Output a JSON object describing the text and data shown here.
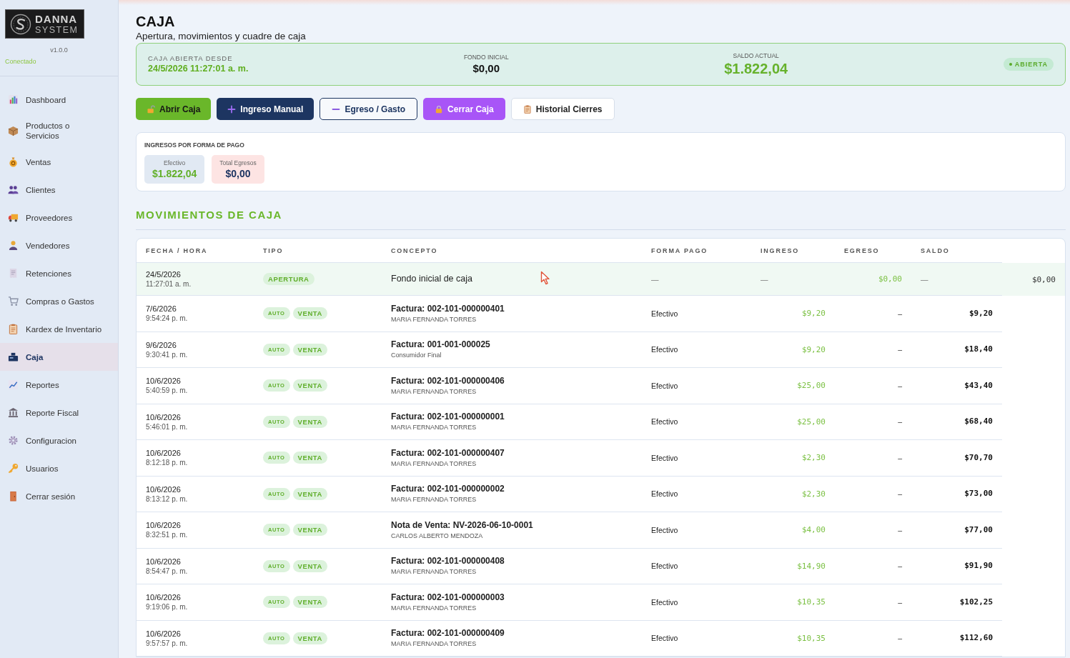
{
  "sidebar": {
    "logo": {
      "name": "DANNA",
      "subtitle": "SYSTEM"
    },
    "version": "v1.0.0",
    "connection": "Conectado",
    "items": [
      {
        "label": "Dashboard",
        "selected": false
      },
      {
        "label": "Productos o Servicios",
        "selected": false
      },
      {
        "label": "Ventas",
        "selected": false
      },
      {
        "label": "Clientes",
        "selected": false
      },
      {
        "label": "Proveedores",
        "selected": false
      },
      {
        "label": "Vendedores",
        "selected": false
      },
      {
        "label": "Retenciones",
        "selected": false
      },
      {
        "label": "Compras o Gastos",
        "selected": false
      },
      {
        "label": "Kardex de Inventario",
        "selected": false
      },
      {
        "label": "Caja",
        "selected": true
      },
      {
        "label": "Reportes",
        "selected": false
      },
      {
        "label": "Reporte Fiscal",
        "selected": false
      },
      {
        "label": "Configuracion",
        "selected": false
      },
      {
        "label": "Usuarios",
        "selected": false
      },
      {
        "label": "Cerrar sesión",
        "selected": false
      }
    ]
  },
  "header": {
    "title": "CAJA",
    "subtitle": "Apertura, movimientos y cuadre de caja"
  },
  "status_card": {
    "since_label": "CAJA ABIERTA DESDE",
    "since": "24/5/2026 11:27:01 a. m.",
    "fund_label": "FONDO INICIAL",
    "fund": "$0,00",
    "balance_label": "SALDO ACTUAL",
    "balance": "$1.822,04",
    "badge": "ABIERTA"
  },
  "actions": [
    {
      "label": "Abrir Caja",
      "kind": "success"
    },
    {
      "label": "Ingreso Manual",
      "kind": "primary"
    },
    {
      "label": "Egreso / Gasto",
      "kind": "outline"
    },
    {
      "label": "Cerrar Caja",
      "kind": "danger"
    },
    {
      "label": "Historial Cierres",
      "kind": "secondary"
    }
  ],
  "payment_summary": {
    "title": "INGRESOS POR FORMA DE PAGO",
    "tiles": [
      {
        "label": "Efectivo",
        "value": "$1.822,04",
        "kind": "income"
      },
      {
        "label": "Total Egresos",
        "value": "$0,00",
        "kind": "expense"
      }
    ]
  },
  "movements": {
    "title": "MOVIMIENTOS DE CAJA",
    "columns": [
      "FECHA / HORA",
      "TIPO",
      "CONCEPTO",
      "FORMA PAGO",
      "INGRESO",
      "EGRESO",
      "SALDO"
    ],
    "rows": [
      {
        "kind": "opening",
        "cells": [
          {
            "kind": "datetime",
            "date": "24/5/2026",
            "time": "11:27:01 a. m."
          },
          {
            "kind": "tags",
            "tags": [
              {
                "label": "APERTURA",
                "kind": "type"
              }
            ]
          },
          {
            "kind": "concept",
            "text": "Fondo inicial de caja"
          },
          {
            "kind": "muted",
            "text": "—"
          },
          {
            "kind": "muted",
            "text": "—"
          },
          {
            "kind": "income",
            "text": "$0,00"
          },
          {
            "kind": "muted",
            "text": "—"
          },
          {
            "kind": "amount",
            "text": "$0,00"
          }
        ]
      },
      {
        "kind": "sale",
        "cells": [
          {
            "kind": "datetime",
            "date": "7/6/2026",
            "time": "9:54:24 p. m."
          },
          {
            "kind": "tags",
            "tags": [
              {
                "label": "AUTO",
                "kind": "source"
              },
              {
                "label": "VENTA",
                "kind": "type"
              }
            ]
          },
          {
            "kind": "concept",
            "text": "Factura: 002-101-000000401",
            "subtext": "MARIA FERNANDA TORRES"
          },
          {
            "kind": "text",
            "text": "Efectivo"
          },
          {
            "kind": "income",
            "text": "$9,20"
          },
          {
            "kind": "dash",
            "text": "–"
          },
          {
            "kind": "balance",
            "text": "$9,20"
          }
        ]
      },
      {
        "kind": "sale",
        "cells": [
          {
            "kind": "datetime",
            "date": "9/6/2026",
            "time": "9:30:41 p. m."
          },
          {
            "kind": "tags",
            "tags": [
              {
                "label": "AUTO",
                "kind": "source"
              },
              {
                "label": "VENTA",
                "kind": "type"
              }
            ]
          },
          {
            "kind": "concept",
            "text": "Factura: 001-001-000025",
            "subtext": "Consumidor Final"
          },
          {
            "kind": "text",
            "text": "Efectivo"
          },
          {
            "kind": "income",
            "text": "$9,20"
          },
          {
            "kind": "dash",
            "text": "–"
          },
          {
            "kind": "balance",
            "text": "$18,40"
          }
        ]
      },
      {
        "kind": "sale",
        "cells": [
          {
            "kind": "datetime",
            "date": "10/6/2026",
            "time": "5:40:59 p. m."
          },
          {
            "kind": "tags",
            "tags": [
              {
                "label": "AUTO",
                "kind": "source"
              },
              {
                "label": "VENTA",
                "kind": "type"
              }
            ]
          },
          {
            "kind": "concept",
            "text": "Factura: 002-101-000000406",
            "subtext": "MARIA FERNANDA TORRES"
          },
          {
            "kind": "text",
            "text": "Efectivo"
          },
          {
            "kind": "income",
            "text": "$25,00"
          },
          {
            "kind": "dash",
            "text": "–"
          },
          {
            "kind": "balance",
            "text": "$43,40"
          }
        ]
      },
      {
        "kind": "sale",
        "cells": [
          {
            "kind": "datetime",
            "date": "10/6/2026",
            "time": "5:46:01 p. m."
          },
          {
            "kind": "tags",
            "tags": [
              {
                "label": "AUTO",
                "kind": "source"
              },
              {
                "label": "VENTA",
                "kind": "type"
              }
            ]
          },
          {
            "kind": "concept",
            "text": "Factura: 002-101-000000001",
            "subtext": "MARIA FERNANDA TORRES"
          },
          {
            "kind": "text",
            "text": "Efectivo"
          },
          {
            "kind": "income",
            "text": "$25,00"
          },
          {
            "kind": "dash",
            "text": "–"
          },
          {
            "kind": "balance",
            "text": "$68,40"
          }
        ]
      },
      {
        "kind": "sale",
        "cells": [
          {
            "kind": "datetime",
            "date": "10/6/2026",
            "time": "8:12:18 p. m."
          },
          {
            "kind": "tags",
            "tags": [
              {
                "label": "AUTO",
                "kind": "source"
              },
              {
                "label": "VENTA",
                "kind": "type"
              }
            ]
          },
          {
            "kind": "concept",
            "text": "Factura: 002-101-000000407",
            "subtext": "MARIA FERNANDA TORRES"
          },
          {
            "kind": "text",
            "text": "Efectivo"
          },
          {
            "kind": "income",
            "text": "$2,30"
          },
          {
            "kind": "dash",
            "text": "–"
          },
          {
            "kind": "balance",
            "text": "$70,70"
          }
        ]
      },
      {
        "kind": "sale",
        "cells": [
          {
            "kind": "datetime",
            "date": "10/6/2026",
            "time": "8:13:12 p. m."
          },
          {
            "kind": "tags",
            "tags": [
              {
                "label": "AUTO",
                "kind": "source"
              },
              {
                "label": "VENTA",
                "kind": "type"
              }
            ]
          },
          {
            "kind": "concept",
            "text": "Factura: 002-101-000000002",
            "subtext": "MARIA FERNANDA TORRES"
          },
          {
            "kind": "text",
            "text": "Efectivo"
          },
          {
            "kind": "income",
            "text": "$2,30"
          },
          {
            "kind": "dash",
            "text": "–"
          },
          {
            "kind": "balance",
            "text": "$73,00"
          }
        ]
      },
      {
        "kind": "sale",
        "cells": [
          {
            "kind": "datetime",
            "date": "10/6/2026",
            "time": "8:32:51 p. m."
          },
          {
            "kind": "tags",
            "tags": [
              {
                "label": "AUTO",
                "kind": "source"
              },
              {
                "label": "VENTA",
                "kind": "type"
              }
            ]
          },
          {
            "kind": "concept",
            "text": "Nota de Venta: NV-2026-06-10-0001",
            "subtext": "CARLOS ALBERTO MENDOZA"
          },
          {
            "kind": "text",
            "text": "Efectivo"
          },
          {
            "kind": "income",
            "text": "$4,00"
          },
          {
            "kind": "dash",
            "text": "–"
          },
          {
            "kind": "balance",
            "text": "$77,00"
          }
        ]
      },
      {
        "kind": "sale",
        "cells": [
          {
            "kind": "datetime",
            "date": "10/6/2026",
            "time": "8:54:47 p. m."
          },
          {
            "kind": "tags",
            "tags": [
              {
                "label": "AUTO",
                "kind": "source"
              },
              {
                "label": "VENTA",
                "kind": "type"
              }
            ]
          },
          {
            "kind": "concept",
            "text": "Factura: 002-101-000000408",
            "subtext": "MARIA FERNANDA TORRES"
          },
          {
            "kind": "text",
            "text": "Efectivo"
          },
          {
            "kind": "income",
            "text": "$14,90"
          },
          {
            "kind": "dash",
            "text": "–"
          },
          {
            "kind": "balance",
            "text": "$91,90"
          }
        ]
      },
      {
        "kind": "sale",
        "cells": [
          {
            "kind": "datetime",
            "date": "10/6/2026",
            "time": "9:19:06 p. m."
          },
          {
            "kind": "tags",
            "tags": [
              {
                "label": "AUTO",
                "kind": "source"
              },
              {
                "label": "VENTA",
                "kind": "type"
              }
            ]
          },
          {
            "kind": "concept",
            "text": "Factura: 002-101-000000003",
            "subtext": "MARIA FERNANDA TORRES"
          },
          {
            "kind": "text",
            "text": "Efectivo"
          },
          {
            "kind": "income",
            "text": "$10,35"
          },
          {
            "kind": "dash",
            "text": "–"
          },
          {
            "kind": "balance",
            "text": "$102,25"
          }
        ]
      },
      {
        "kind": "sale",
        "cells": [
          {
            "kind": "datetime",
            "date": "10/6/2026",
            "time": "9:57:57 p. m."
          },
          {
            "kind": "tags",
            "tags": [
              {
                "label": "AUTO",
                "kind": "source"
              },
              {
                "label": "VENTA",
                "kind": "type"
              }
            ]
          },
          {
            "kind": "concept",
            "text": "Factura: 002-101-000000409",
            "subtext": "MARIA FERNANDA TORRES"
          },
          {
            "kind": "text",
            "text": "Efectivo"
          },
          {
            "kind": "income",
            "text": "$10,35"
          },
          {
            "kind": "dash",
            "text": "–"
          },
          {
            "kind": "balance",
            "text": "$112,60"
          }
        ]
      }
    ]
  }
}
